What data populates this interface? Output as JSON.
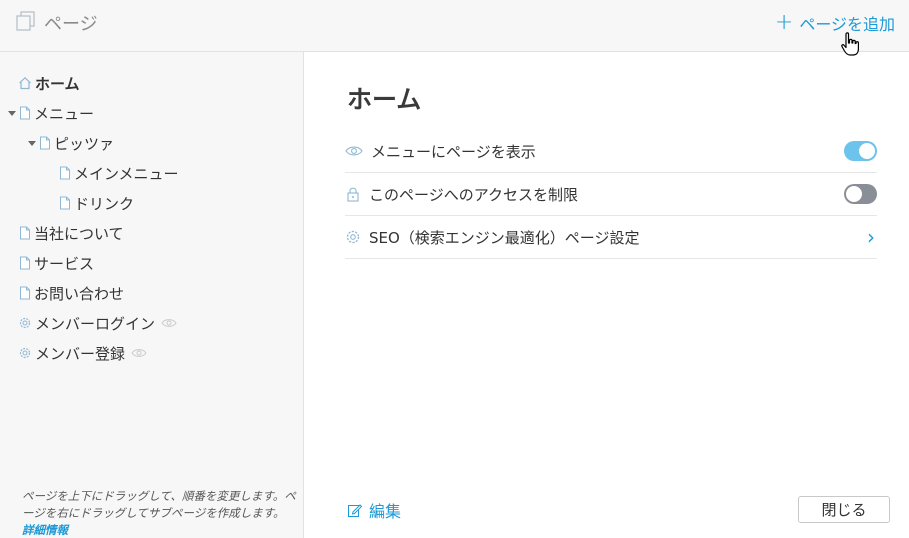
{
  "header": {
    "title": "ページ",
    "title_icon": "pages-icon",
    "add_page_label": "ページを追加",
    "add_page_icon": "plus-icon"
  },
  "sidebar": {
    "items": [
      {
        "label": "ホーム",
        "icon": "home-icon",
        "active": true
      },
      {
        "label": "メニュー",
        "icon": "page-icon",
        "expanded": true
      },
      {
        "label": "ピッツァ",
        "icon": "page-icon",
        "expanded": true
      },
      {
        "label": "メインメニュー",
        "icon": "page-icon"
      },
      {
        "label": "ドリンク",
        "icon": "page-icon"
      },
      {
        "label": "当社について",
        "icon": "page-icon"
      },
      {
        "label": "サービス",
        "icon": "page-icon"
      },
      {
        "label": "お問い合わせ",
        "icon": "page-icon"
      },
      {
        "label": "メンバーログイン",
        "icon": "gear-icon",
        "hidden_in_menu": true
      },
      {
        "label": "メンバー登録",
        "icon": "gear-icon",
        "hidden_in_menu": true
      }
    ],
    "note_text": "ページを上下にドラッグして、順番を変更します。ページを右にドラッグしてサブページを作成します。",
    "note_link": "詳細情報"
  },
  "main": {
    "title": "ホーム",
    "rows": [
      {
        "label": "メニューにページを表示",
        "icon": "eye-icon",
        "toggle": "on"
      },
      {
        "label": "このページへのアクセスを制限",
        "icon": "lock-icon",
        "toggle": "off"
      },
      {
        "label": "SEO（検索エンジン最適化）ページ設定",
        "icon": "gear-icon",
        "chevron": "›"
      }
    ],
    "edit_label": "編集",
    "close_label": "閉じる"
  },
  "colors": {
    "accent": "#1d9ad6",
    "toggle_on": "#6cc3ec",
    "toggle_off": "#8a8f97",
    "sidebar_bg": "#f7f7f7"
  }
}
